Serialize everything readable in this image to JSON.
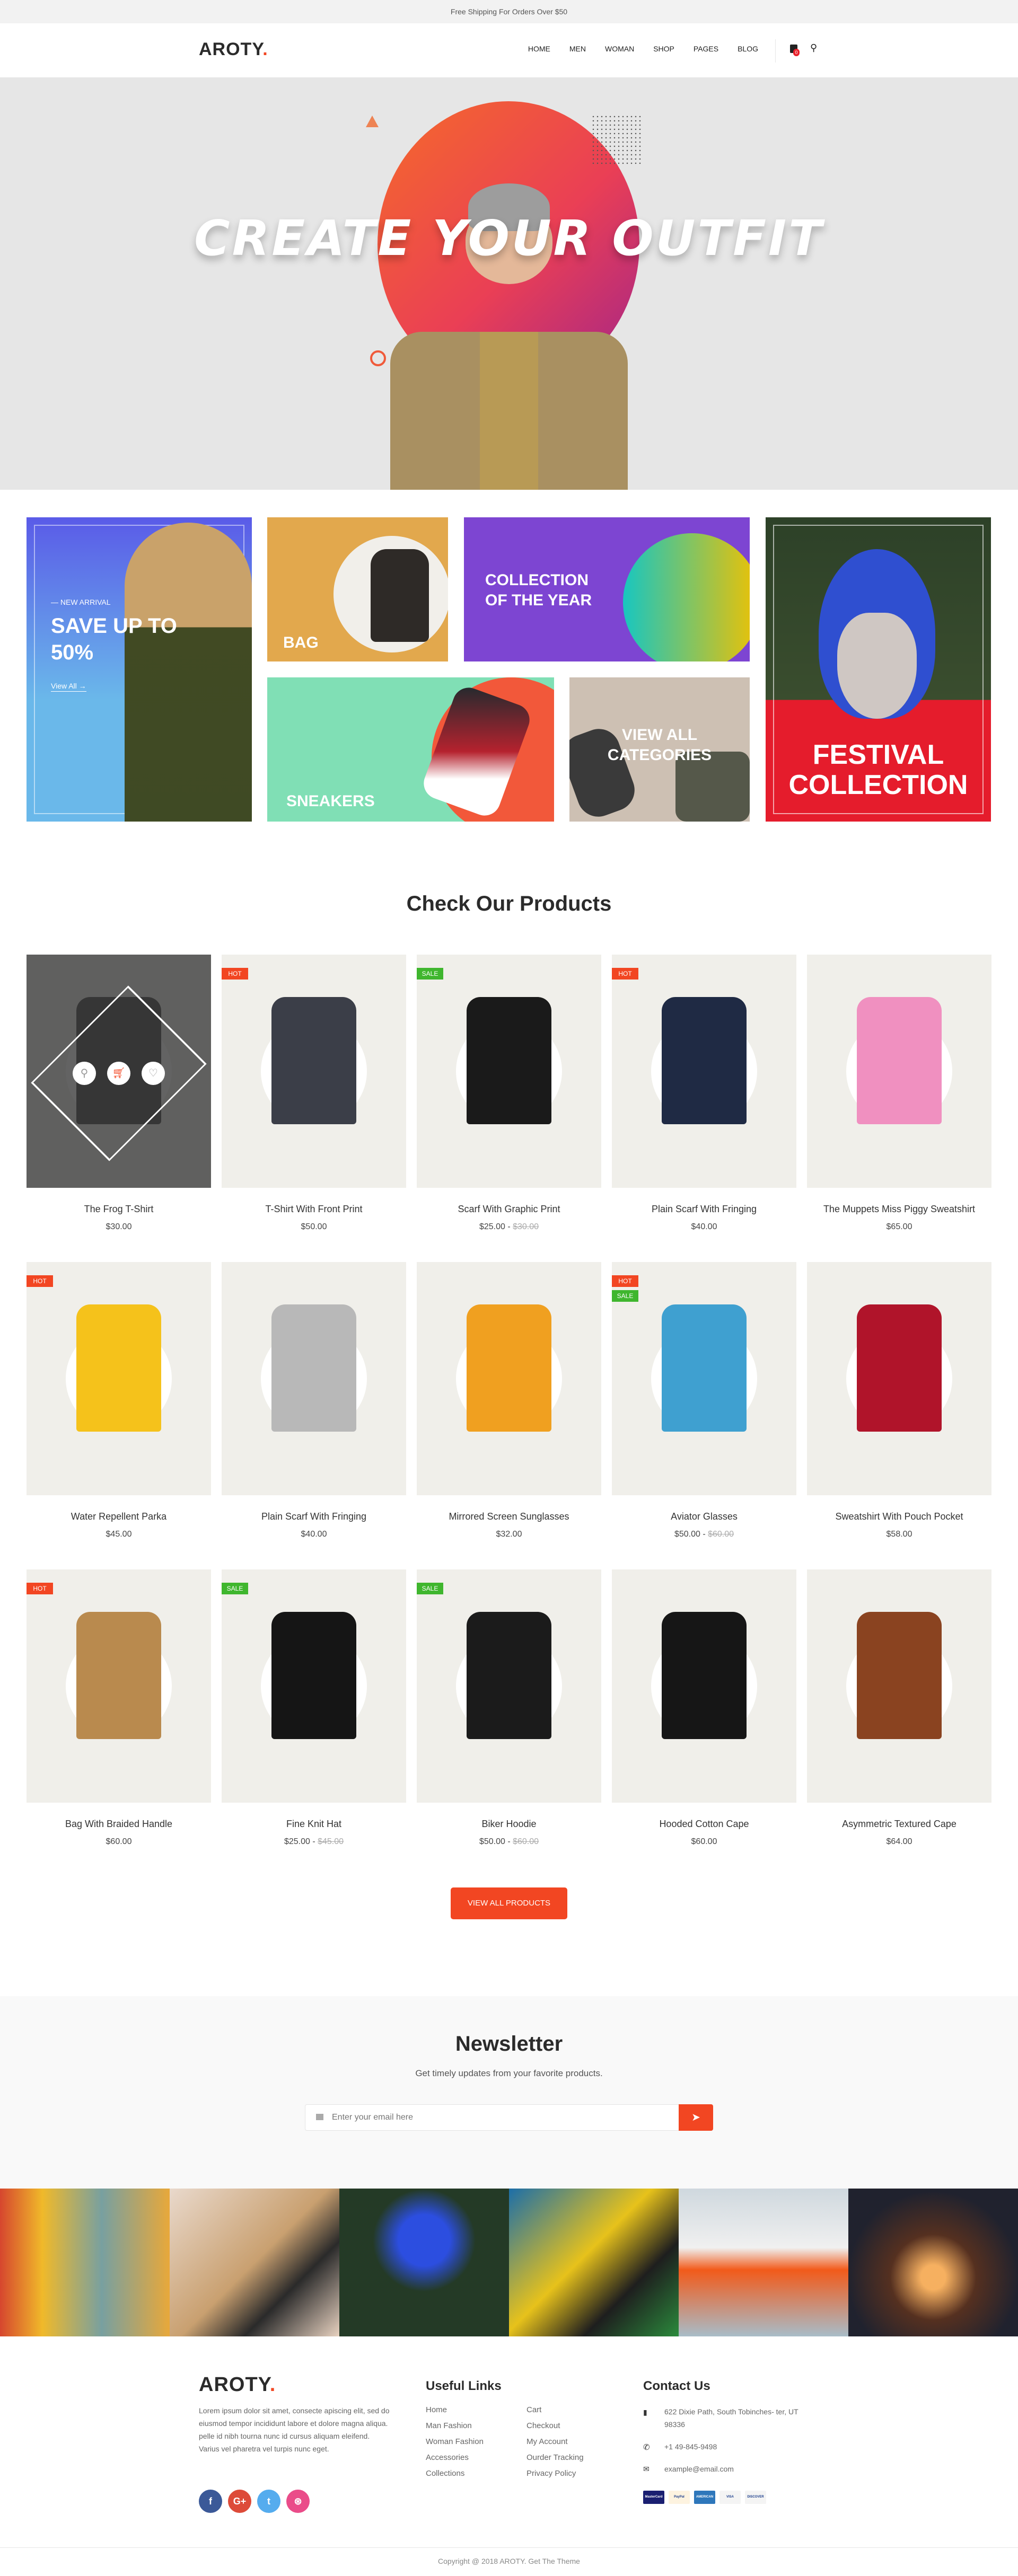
{
  "topbar": {
    "text": "Free Shipping For Orders Over $50"
  },
  "header": {
    "logo": "AROTY",
    "logo_dot": ".",
    "nav": [
      "HOME",
      "MEN",
      "WOMAN",
      "SHOP",
      "PAGES",
      "BLOG"
    ],
    "cart_count": "0",
    "accent": "#f24622"
  },
  "hero": {
    "title": "CREATE YOUR OUTFIT"
  },
  "banners": {
    "new_arrival": {
      "kicker": "— NEW ARRIVAL",
      "title": "SAVE UP TO 50%",
      "link": "View All →"
    },
    "bag": {
      "label": "BAG"
    },
    "collection": {
      "label": "COLLECTION OF THE YEAR"
    },
    "sneakers": {
      "label": "SNEAKERS"
    },
    "categories": {
      "label": "VIEW ALL CATEGORIES"
    },
    "festival": {
      "label": "FESTIVAL COLLECTION"
    }
  },
  "products_section": {
    "title": "Check Our Products",
    "view_all": "VIEW ALL PRODUCTS"
  },
  "products": [
    {
      "name": "The Frog T-Shirt",
      "price": "$30.00",
      "badge": "",
      "hover": true,
      "color": "#222222"
    },
    {
      "name": "T-Shirt With Front Print",
      "price": "$50.00",
      "badge": "HOT",
      "color": "#3b3e48"
    },
    {
      "name": "Scarf With Graphic Print",
      "price": "$25.00",
      "old_price": "$30.00",
      "badge": "SALE",
      "color": "#1a1a1a"
    },
    {
      "name": "Plain Scarf With Fringing",
      "price": "$40.00",
      "badge": "HOT",
      "color": "#1f2a44"
    },
    {
      "name": "The Muppets Miss Piggy Sweatshirt",
      "price": "$65.00",
      "badge": "",
      "color": "#f090c0"
    },
    {
      "name": "Water Repellent Parka",
      "price": "$45.00",
      "badge": "HOT",
      "color": "#f5c21b"
    },
    {
      "name": "Plain Scarf With Fringing",
      "price": "$40.00",
      "badge": "",
      "color": "#b8b8b8"
    },
    {
      "name": "Mirrored Screen Sunglasses",
      "price": "$32.00",
      "badge": "",
      "color": "#f0a020"
    },
    {
      "name": "Aviator Glasses",
      "price": "$50.00",
      "old_price": "$60.00",
      "badge": "HOT",
      "badge2": "SALE",
      "color": "#3fa0d0"
    },
    {
      "name": "Sweatshirt With Pouch Pocket",
      "price": "$58.00",
      "badge": "",
      "color": "#b0142a"
    },
    {
      "name": "Bag With Braided Handle",
      "price": "$60.00",
      "badge": "HOT",
      "color": "#b98a4e"
    },
    {
      "name": "Fine Knit Hat",
      "price": "$25.00",
      "old_price": "$45.00",
      "badge": "SALE",
      "color": "#151515"
    },
    {
      "name": "Biker Hoodie",
      "price": "$50.00",
      "old_price": "$60.00",
      "badge": "SALE",
      "color": "#1b1b1b"
    },
    {
      "name": "Hooded Cotton Cape",
      "price": "$60.00",
      "badge": "",
      "color": "#161616"
    },
    {
      "name": "Asymmetric Textured Cape",
      "price": "$64.00",
      "badge": "",
      "color": "#8a4320"
    }
  ],
  "badge_colors": {
    "HOT": "#f24622",
    "SALE": "#3fb62e"
  },
  "newsletter": {
    "title": "Newsletter",
    "subtitle": "Get timely updates from your favorite products.",
    "placeholder": "Enter your email here"
  },
  "footer": {
    "logo": "AROTY",
    "logo_dot": ".",
    "about": "Lorem ipsum dolor sit amet, consecte apiscing elit, sed do eiusmod tempor incididunt labore et dolore magna aliqua. pelle id nibh tourna nunc id cursus aliquam eleifend. Varius vel pharetra vel turpis nunc eget.",
    "links_title": "Useful Links",
    "links_col1": [
      "Home",
      "Man Fashion",
      "Woman Fashion",
      "Accessories",
      "Collections"
    ],
    "links_col2": [
      "Cart",
      "Checkout",
      "My Account",
      "Ourder Tracking",
      "Privacy Policy"
    ],
    "contact_title": "Contact Us",
    "address": "622 Dixie Path, South Tobinches- ter, UT 98336",
    "phone": "+1 49-845-9498",
    "email": "example@email.com",
    "socials": [
      {
        "icon": "facebook",
        "glyph": "f",
        "color": "#3b5998"
      },
      {
        "icon": "google-plus",
        "glyph": "G+",
        "color": "#dd4b39"
      },
      {
        "icon": "twitter",
        "glyph": "t",
        "color": "#55acee"
      },
      {
        "icon": "dribbble",
        "glyph": "⊛",
        "color": "#ea4c89"
      }
    ],
    "payments": [
      {
        "name": "MasterCard",
        "color": "#1a1f71"
      },
      {
        "name": "PayPal",
        "color": "#fdf3e0"
      },
      {
        "name": "AMERICAN EXPRESS",
        "color": "#2e77bb"
      },
      {
        "name": "VISA",
        "color": "#f4f4f4"
      },
      {
        "name": "DISCOVER",
        "color": "#f4f4f4"
      }
    ],
    "copyright": "Copyright @ 2018 AROTY. Get The Theme"
  }
}
